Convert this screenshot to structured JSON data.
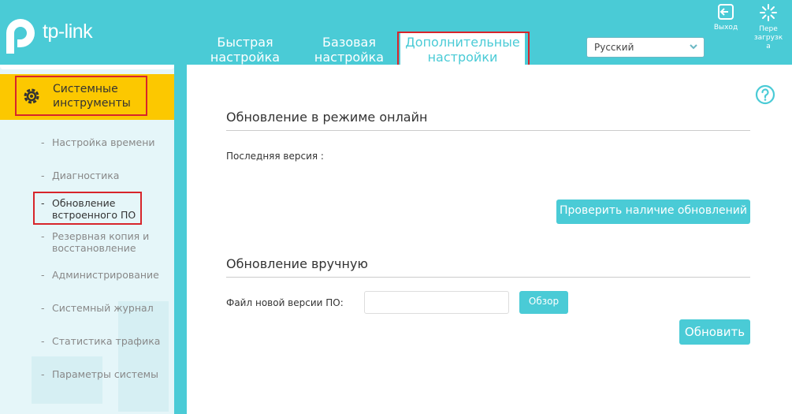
{
  "brand": {
    "logo_text": "tp-link",
    "accent": "#4acbd6",
    "highlight": "#fcc800",
    "annotation": "#d7252b"
  },
  "top_nav": {
    "tabs": [
      {
        "label_line1": "Быстрая",
        "label_line2": "настройка"
      },
      {
        "label_line1": "Базовая",
        "label_line2": "настройка"
      },
      {
        "label_line1": "Дополнительные",
        "label_line2": "настройки"
      }
    ],
    "language": {
      "selected": "Русский"
    },
    "exit_label": "Выход",
    "reboot_label_line1": "Пере",
    "reboot_label_line2": "загрузк",
    "reboot_label_line3": "а"
  },
  "sidebar": {
    "section": {
      "label_line1": "Системные",
      "label_line2": "инструменты",
      "icon": "gear-icon"
    },
    "items": [
      {
        "line1": "Настройка времени",
        "line2": ""
      },
      {
        "line1": "Диагностика",
        "line2": ""
      },
      {
        "line1": "Обновление",
        "line2": "встроенного ПО"
      },
      {
        "line1": "Резервная копия и",
        "line2": "восстановление"
      },
      {
        "line1": "Администрирование",
        "line2": ""
      },
      {
        "line1": "Системный журнал",
        "line2": ""
      },
      {
        "line1": "Статистика трафика",
        "line2": ""
      },
      {
        "line1": "Параметры системы",
        "line2": ""
      }
    ],
    "dash": "-"
  },
  "main": {
    "online": {
      "title": "Обновление в режиме онлайн",
      "latest_version_label": "Последняя версия :",
      "check_button": "Проверить наличие обновлений"
    },
    "manual": {
      "title": "Обновление вручную",
      "file_label": "Файл новой версии ПО:",
      "browse_button": "Обзор",
      "update_button": "Обновить"
    }
  }
}
